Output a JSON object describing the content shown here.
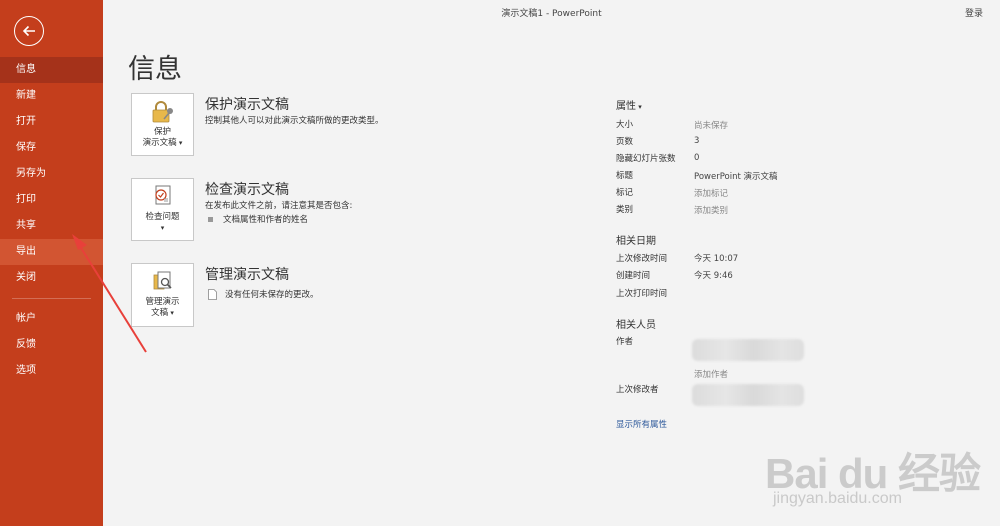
{
  "titlebar": {
    "title": "演示文稿1  -  PowerPoint",
    "signin": "登录"
  },
  "sidebar": {
    "items": [
      {
        "label": "信息"
      },
      {
        "label": "新建"
      },
      {
        "label": "打开"
      },
      {
        "label": "保存"
      },
      {
        "label": "另存为"
      },
      {
        "label": "打印"
      },
      {
        "label": "共享"
      },
      {
        "label": "导出"
      },
      {
        "label": "关闭"
      },
      {
        "label": "帐户"
      },
      {
        "label": "反馈"
      },
      {
        "label": "选项"
      }
    ],
    "active_index": 0,
    "hover_index": 7
  },
  "page_title": "信息",
  "cards": {
    "protect": {
      "btn_line1": "保护",
      "btn_line2": "演示文稿",
      "title": "保护演示文稿",
      "desc": "控制其他人可以对此演示文稿所做的更改类型。"
    },
    "inspect": {
      "btn_line1": "检查问题",
      "title": "检查演示文稿",
      "desc": "在发布此文件之前，请注意其是否包含:",
      "bullet": "文档属性和作者的姓名"
    },
    "manage": {
      "btn_line1": "管理演示",
      "btn_line2": "文稿",
      "title": "管理演示文稿",
      "desc": "没有任何未保存的更改。"
    }
  },
  "props": {
    "heading": "属性",
    "rows": [
      {
        "label": "大小",
        "value": "尚未保存"
      },
      {
        "label": "页数",
        "value": "3"
      },
      {
        "label": "隐藏幻灯片张数",
        "value": "0"
      },
      {
        "label": "标题",
        "value": "PowerPoint 演示文稿"
      },
      {
        "label": "标记",
        "value": "添加标记"
      },
      {
        "label": "类别",
        "value": "添加类别"
      }
    ],
    "dates_heading": "相关日期",
    "dates": [
      {
        "label": "上次修改时间",
        "value": "今天 10:07"
      },
      {
        "label": "创建时间",
        "value": "今天 9:46"
      },
      {
        "label": "上次打印时间",
        "value": ""
      }
    ],
    "people_heading": "相关人员",
    "author_label": "作者",
    "add_author": "添加作者",
    "last_modified_by_label": "上次修改者",
    "show_all": "显示所有属性"
  },
  "watermark": {
    "brand": "Bai du 经验",
    "url": "jingyan.baidu.com"
  },
  "colors": {
    "sidebar": "#c43e1c",
    "sidebar_active": "#a5321a",
    "annotation_arrow": "#e8403a",
    "link": "#2b579a"
  }
}
